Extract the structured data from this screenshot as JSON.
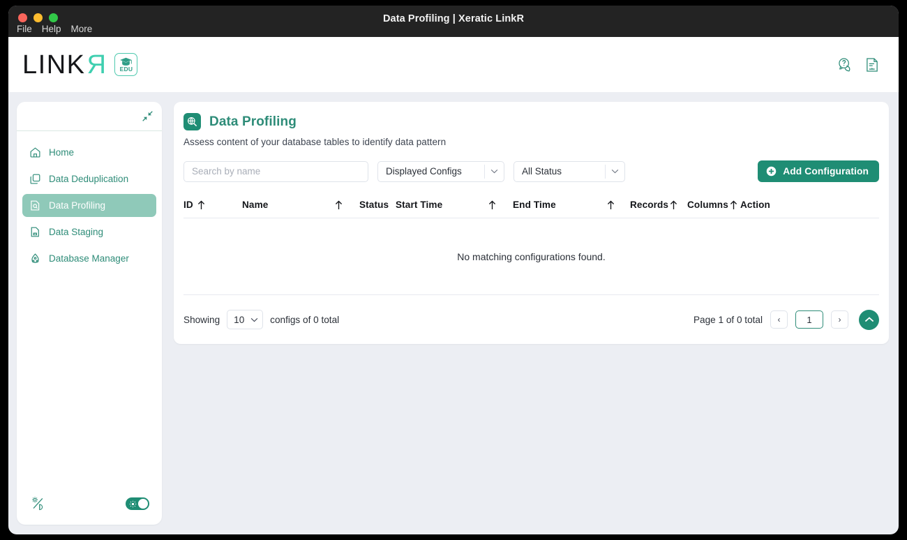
{
  "window": {
    "title": "Data Profiling | Xeratic LinkR",
    "traffic_colors": {
      "close": "#f9655b",
      "minimize": "#fdbc2f",
      "maximize": "#32c748"
    },
    "menu": [
      "File",
      "Help",
      "More"
    ]
  },
  "brand": {
    "logo_main": "LINK",
    "logo_accent": "R",
    "edu_label": "EDU",
    "accent_color": "#3fcfb0",
    "primary_color": "#1f8d74"
  },
  "header": {
    "icons": [
      {
        "name": "help-chat-icon",
        "label": "Help"
      },
      {
        "name": "report-document-icon",
        "label": "Report"
      }
    ]
  },
  "sidebar": {
    "collapse_icon": "collapse-inward-icon",
    "items": [
      {
        "label": "Home",
        "icon": "home-icon",
        "active": false
      },
      {
        "label": "Data Deduplication",
        "icon": "copies-icon",
        "active": false
      },
      {
        "label": "Data Profiling",
        "icon": "document-search-icon",
        "active": true
      },
      {
        "label": "Data Staging",
        "icon": "document-import-icon",
        "active": false
      },
      {
        "label": "Database Manager",
        "icon": "database-nodes-icon",
        "active": false
      }
    ],
    "theme": {
      "icon": "light-dark-mode-icon",
      "toggle_on": true,
      "toggle_color": "#1f8d74"
    }
  },
  "page": {
    "icon": "data-profiling-search-icon",
    "title": "Data Profiling",
    "subtitle": "Assess content of your database tables to identify data pattern"
  },
  "toolbar": {
    "search": {
      "value": "",
      "placeholder": "Search by name"
    },
    "config_filter": {
      "value": "Displayed Configs"
    },
    "status_filter": {
      "value": "All Status"
    },
    "add_button": {
      "label": "Add Configuration",
      "icon": "plus-circle-icon"
    }
  },
  "table": {
    "columns": [
      {
        "label": "ID",
        "sortable": true
      },
      {
        "label": "Name",
        "sortable": true
      },
      {
        "label": "Status",
        "sortable": false
      },
      {
        "label": "Start Time",
        "sortable": true
      },
      {
        "label": "End Time",
        "sortable": true
      },
      {
        "label": "Records",
        "sortable": true
      },
      {
        "label": "Columns",
        "sortable": true
      },
      {
        "label": "Action",
        "sortable": false
      }
    ],
    "rows": [],
    "empty_message": "No matching configurations found."
  },
  "footer": {
    "showing_prefix": "Showing",
    "page_size": "10",
    "showing_suffix": "configs of 0 total",
    "page_label": "Page 1 of 0 total",
    "prev_label": "‹",
    "next_label": "›",
    "page_input_value": "1",
    "scroll_top_icon": "chevron-up-icon"
  }
}
